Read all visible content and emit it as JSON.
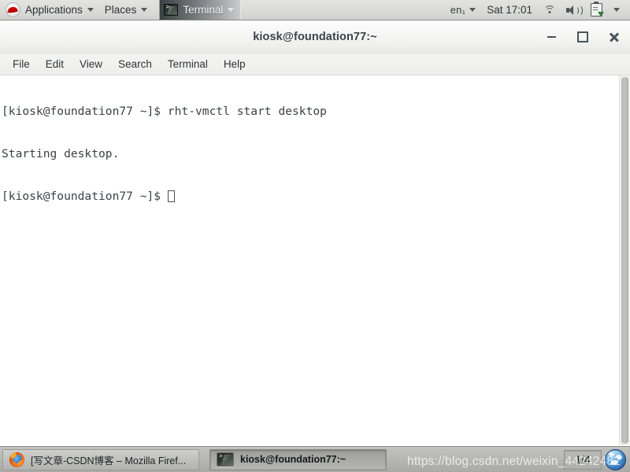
{
  "top_panel": {
    "applications_menu": {
      "label": "Applications",
      "icon": "redhat-logo-icon",
      "caret": "chevron-down-icon"
    },
    "places_menu": {
      "label": "Places",
      "caret": "chevron-down-icon"
    },
    "window_list": [
      {
        "label": "Terminal",
        "icon": "terminal-icon",
        "active": true,
        "caret": "chevron-down-icon"
      }
    ],
    "keyboard_indicator": {
      "label": "en₁",
      "caret": "chevron-down-icon"
    },
    "clock": {
      "label": "Sat 17:01"
    },
    "tray": [
      {
        "icon": "wifi-icon"
      },
      {
        "icon": "volume-speaker-icon"
      },
      {
        "icon": "software-update-icon"
      },
      {
        "icon": "chevron-down-icon"
      }
    ]
  },
  "window": {
    "title": "kiosk@foundation77:~",
    "controls": {
      "minimize": {
        "icon": "minimize-icon",
        "glyph": "–"
      },
      "maximize": {
        "icon": "maximize-icon",
        "glyph": "□"
      },
      "close": {
        "icon": "close-icon",
        "glyph": "✕"
      }
    },
    "menubar": [
      "File",
      "Edit",
      "View",
      "Search",
      "Terminal",
      "Help"
    ]
  },
  "terminal": {
    "prompt": "[kiosk@foundation77 ~]$",
    "lines": [
      "[kiosk@foundation77 ~]$ rht-vmctl start desktop",
      "Starting desktop.",
      "[kiosk@foundation77 ~]$ "
    ],
    "command": "rht-vmctl start desktop",
    "output": "Starting desktop.",
    "cursor": "block-hollow",
    "foreground_color": "#3c4245",
    "background_color": "#ffffff",
    "scrollbar": {
      "name": "terminal-scrollbar",
      "position": "right"
    }
  },
  "taskbar": {
    "items": [
      {
        "label": "[写文章-CSDN博客 – Mozilla Firef...",
        "icon": "firefox-icon",
        "active": false
      },
      {
        "label": "kiosk@foundation77:~",
        "icon": "terminal-icon",
        "active": true
      }
    ],
    "workspace_switcher": {
      "label": "1/4",
      "icon": "workspace-switcher-icon"
    },
    "trash_or_globe": {
      "icon": "globe-icon"
    }
  },
  "watermark": {
    "text": "https://blog.csdn.net/weixin_44242482"
  }
}
